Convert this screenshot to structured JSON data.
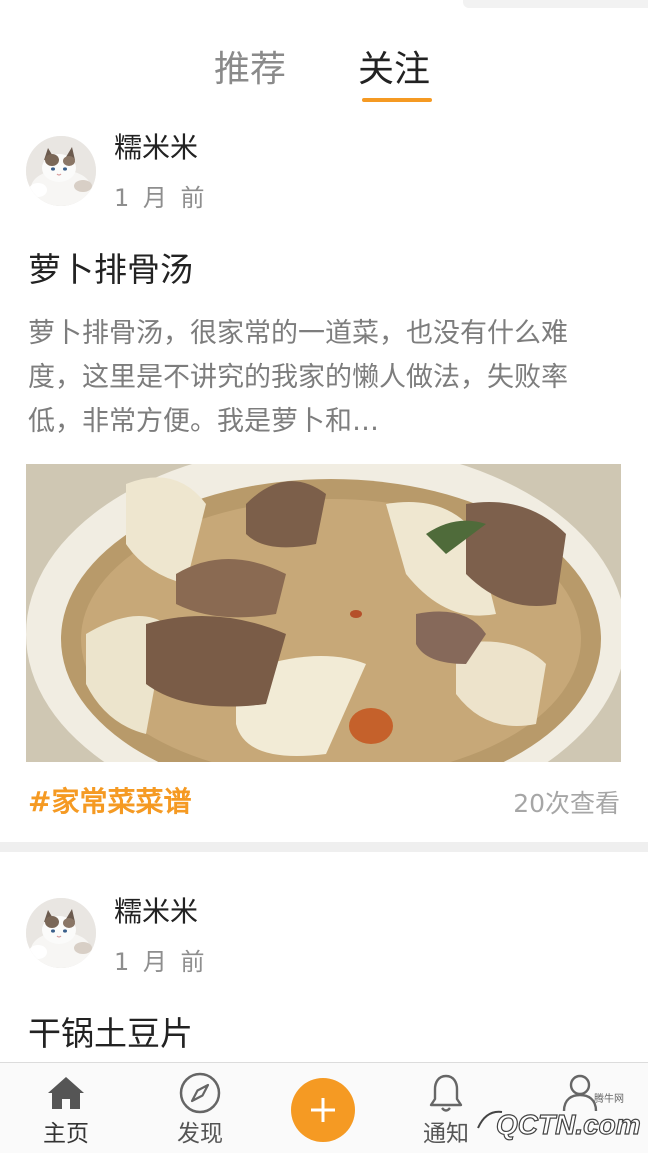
{
  "tabs": {
    "recommend": "推荐",
    "follow": "关注",
    "active": "关注"
  },
  "posts": [
    {
      "user": "糯米米",
      "time": "1 月 前",
      "title": "萝卜排骨汤",
      "desc": "萝卜排骨汤，很家常的一道菜，也没有什么难度，这里是不讲究的我家的懒人做法，失败率低，非常方便。我是萝卜和…",
      "tag": "#家常菜菜谱",
      "views": "20次查看"
    },
    {
      "user": "糯米米",
      "time": "1 月 前",
      "title": "干锅土豆片"
    }
  ],
  "bottom_nav": {
    "home": "主页",
    "discover": "发现",
    "notify": "通知",
    "add_icon": "plus-icon"
  },
  "watermark": {
    "text": "QCTN.com",
    "sub": "腾牛网"
  },
  "colors": {
    "accent": "#f59a23",
    "text": "#222222",
    "muted": "#8e8e8e"
  }
}
